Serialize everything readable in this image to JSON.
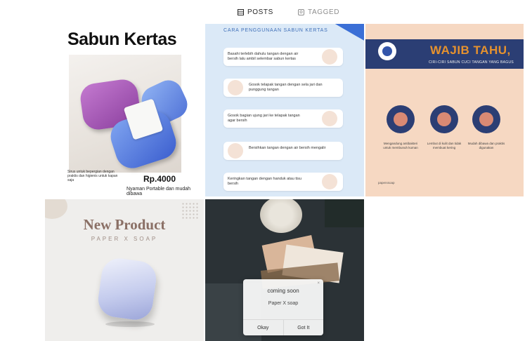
{
  "tabs": [
    {
      "label": "POSTS",
      "icon": "grid-icon",
      "active": true
    },
    {
      "label": "TAGGED",
      "icon": "tag-icon",
      "active": false
    }
  ],
  "posts": {
    "p1": {
      "title": "Sabun Kertas",
      "small_text": "Sirus untuk bepergian dengan praktis dan higienis untuk kapan saja",
      "price": "Rp.4000",
      "subtitle": "Nyaman Portable dan mudah dibawa"
    },
    "p2": {
      "header": "CARA PENGGUNAAN SABUN KERTAS",
      "badge": "",
      "steps": [
        "Basahi terlebih dahulu tangan dengan air bersih lalu ambil selembar sabun kertas",
        "Gosok telapak tangan dengan sela jari dan punggung tangan",
        "Gosok bagian ujung jari ke telapak tangan agar bersih",
        "Bersihkan tangan dengan air bersih mengalir",
        "Keringkan tangan dengan handuk atau tisu bersih"
      ]
    },
    "p3": {
      "title": "WAJIB TAHU,",
      "subtitle": "CIRI-CIRI SABUN CUCI TANGAN YANG BAGUS",
      "captions": [
        "Mengandung antibakteri untuk membunuh kuman",
        "Lembut di kulit dan tidak membuat kering",
        "Mudah dibawa dan praktis digunakan"
      ],
      "footer": "paperxsoap"
    },
    "p4": {
      "title": "New Product",
      "subtitle": "PAPER X SOAP"
    }
  },
  "dialog": {
    "title": "coming soon",
    "message": "Paper X soap",
    "close": "×",
    "ok_label": "Okay",
    "got_it_label": "Got It"
  }
}
